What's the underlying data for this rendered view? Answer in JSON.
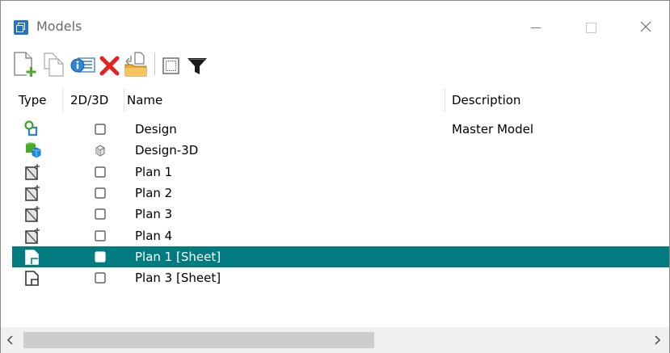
{
  "window": {
    "title": "Models"
  },
  "toolbar": {
    "buttons": [
      {
        "name": "create-model-button",
        "icon": "new-document-plus-icon"
      },
      {
        "name": "copy-model-button",
        "icon": "copy-document-icon"
      },
      {
        "name": "model-properties-button",
        "icon": "properties-icon"
      },
      {
        "name": "delete-model-button",
        "icon": "red-x-delete-icon"
      },
      {
        "name": "import-model-button",
        "icon": "import-folder-icon"
      },
      {
        "name": "select-view-button",
        "icon": "dotted-rectangle-icon"
      },
      {
        "name": "filter-button",
        "icon": "funnel-filter-icon"
      }
    ]
  },
  "columns": {
    "type": "Type",
    "dim": "2D/3D",
    "name": "Name",
    "description": "Description"
  },
  "rows": [
    {
      "type_icon": "design-model-icon",
      "dim_icon": "2d-square-icon",
      "name": "Design",
      "description": "Master Model",
      "selected": false
    },
    {
      "type_icon": "3d-model-icon",
      "dim_icon": "3d-cube-icon",
      "name": "Design-3D",
      "description": "",
      "selected": false
    },
    {
      "type_icon": "drawing-model-icon",
      "dim_icon": "2d-square-icon",
      "name": "Plan 1",
      "description": "",
      "selected": false
    },
    {
      "type_icon": "drawing-model-icon",
      "dim_icon": "2d-square-icon",
      "name": "Plan 2",
      "description": "",
      "selected": false
    },
    {
      "type_icon": "drawing-model-icon",
      "dim_icon": "2d-square-icon",
      "name": "Plan 3",
      "description": "",
      "selected": false
    },
    {
      "type_icon": "drawing-model-icon",
      "dim_icon": "2d-square-icon",
      "name": "Plan 4",
      "description": "",
      "selected": false
    },
    {
      "type_icon": "sheet-model-icon",
      "dim_icon": "2d-square-icon",
      "name": "Plan 1 [Sheet]",
      "description": "",
      "selected": true
    },
    {
      "type_icon": "sheet-model-icon",
      "dim_icon": "2d-square-icon",
      "name": "Plan 3 [Sheet]",
      "description": "",
      "selected": false
    }
  ],
  "colors": {
    "selection": "#007b80",
    "title_icon": "#1f74c8"
  }
}
